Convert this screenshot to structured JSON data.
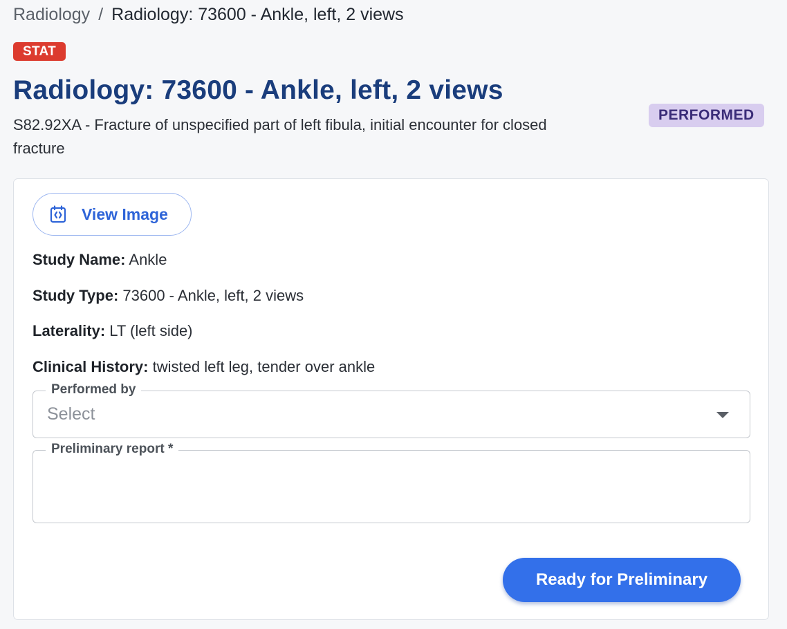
{
  "breadcrumb": {
    "parent": "Radiology",
    "separator": "/",
    "current": "Radiology: 73600 - Ankle, left, 2 views"
  },
  "priority_badge": "STAT",
  "title": "Radiology: 73600 - Ankle, left, 2 views",
  "diagnosis": "S82.92XA - Fracture of unspecified part of left fibula, initial encounter for closed fracture",
  "status_badge": "PERFORMED",
  "card": {
    "view_image": {
      "label": "View Image",
      "icon": "x-ray-image-icon"
    },
    "fields": [
      {
        "key": "Study Name:",
        "value": "Ankle"
      },
      {
        "key": "Study Type:",
        "value": "73600 - Ankle, left, 2 views"
      },
      {
        "key": "Laterality:",
        "value": "LT (left side)"
      },
      {
        "key": "Clinical History:",
        "value": "twisted left leg, tender over ankle"
      }
    ],
    "performed_by": {
      "label": "Performed by",
      "placeholder": "Select"
    },
    "preliminary_report": {
      "label": "Preliminary report *",
      "value": ""
    },
    "submit_label": "Ready for Preliminary"
  },
  "colors": {
    "title": "#1a3d7c",
    "stat_badge": "#dc3b2e",
    "status_badge_bg": "#d8cdef",
    "primary_button": "#3370ea"
  }
}
